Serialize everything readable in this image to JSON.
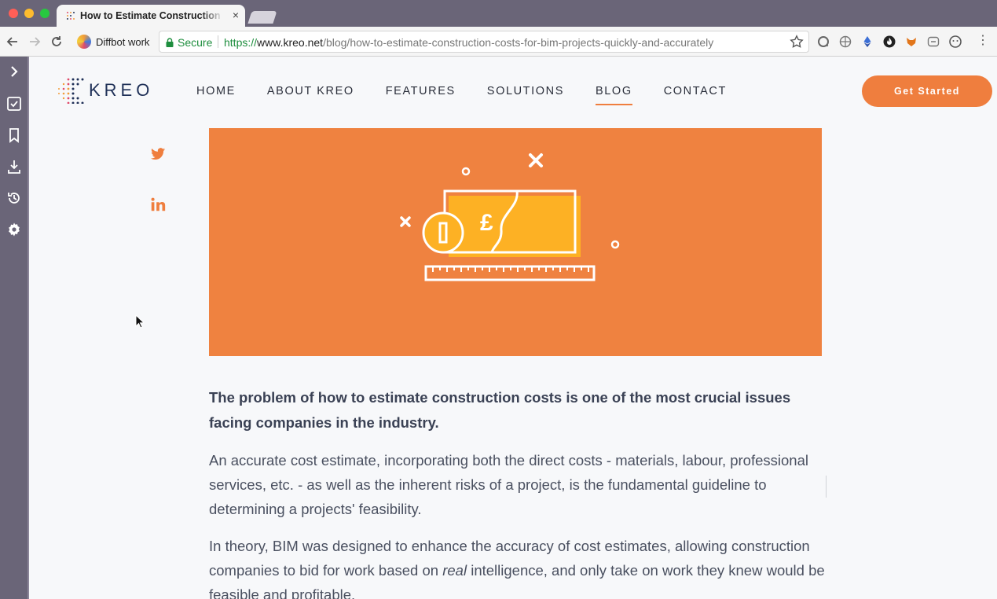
{
  "browser": {
    "tab_title": "How to Estimate Construction Costs for BIM Projects Quickly and Accurately",
    "tab_close": "×",
    "bookmark_label": "Diffbot work",
    "secure_label": "Secure",
    "url_scheme": "https://",
    "url_host": "www.kreo.net",
    "url_path": "/blog/how-to-estimate-construction-costs-for-bim-projects-quickly-and-accurately",
    "menu_glyph": "⋮"
  },
  "site": {
    "logo_text": "KREO",
    "nav": [
      {
        "label": "HOME"
      },
      {
        "label": "ABOUT KREO"
      },
      {
        "label": "FEATURES"
      },
      {
        "label": "SOLUTIONS"
      },
      {
        "label": "BLOG"
      },
      {
        "label": "CONTACT"
      }
    ],
    "cta_label": "Get Started",
    "accent": "#ef7e3e",
    "brand_navy": "#1f3057"
  },
  "hero": {
    "currency_symbol": "£",
    "background": "#ef8240",
    "note_fill": "#fdb124"
  },
  "article": {
    "lead": "The problem of how to estimate construction costs is one of the most crucial issues facing companies in the industry.",
    "para1": "An accurate cost estimate, incorporating both the direct costs - materials, labour, professional services, etc. - as well as the inherent risks of a project, is the fundamental guideline to determining a projects' feasibility.",
    "para2_before": "In theory, BIM was designed to enhance the accuracy of cost estimates, allowing construction companies to bid for work based on ",
    "para2_em": "real",
    "para2_after": " intelligence, and only take on work they knew would be feasible and profitable."
  }
}
